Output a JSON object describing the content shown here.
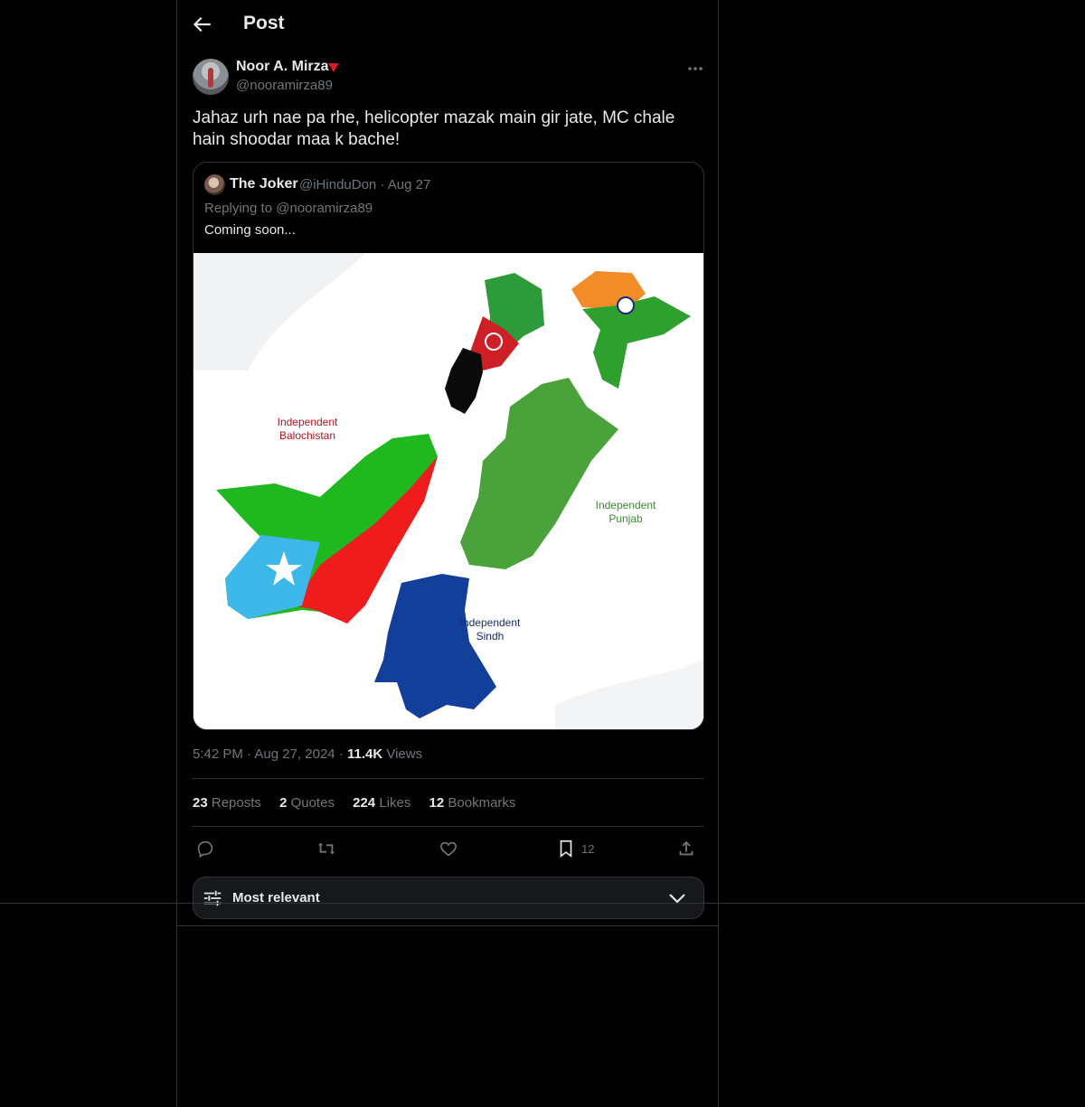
{
  "header": {
    "title": "Post"
  },
  "post": {
    "author_name": "Noor A. Mirza",
    "author_handle": "@nooramirza89",
    "text": "Jahaz urh nae pa rhe, helicopter mazak main gir jate, MC chale hain shoodar maa k bache!",
    "time": "5:42 PM",
    "date": "Aug 27, 2024",
    "views_count": "11.4K",
    "views_label": "Views"
  },
  "quote": {
    "author_name": "The Joker",
    "author_handle": "@iHinduDon",
    "date": "Aug 27",
    "replying_to": "Replying to @nooramirza89",
    "text": "Coming soon...",
    "image_labels": {
      "balochistan_1": "Independent",
      "balochistan_2": "Balochistan",
      "punjab_1": "Independent",
      "punjab_2": "Punjab",
      "sindh_1": "Independent",
      "sindh_2": "Sindh"
    }
  },
  "stats": {
    "reposts_count": "23",
    "reposts_label": "Reposts",
    "quotes_count": "2",
    "quotes_label": "Quotes",
    "likes_count": "224",
    "likes_label": "Likes",
    "bookmarks_count": "12",
    "bookmarks_label": "Bookmarks"
  },
  "actions": {
    "bookmark_count": "12"
  },
  "sort": {
    "label": "Most relevant"
  },
  "colors": {
    "accent_red": "#f4212e",
    "text_primary": "#e7e9ea",
    "text_secondary": "#71767b",
    "border": "#2f3336"
  }
}
